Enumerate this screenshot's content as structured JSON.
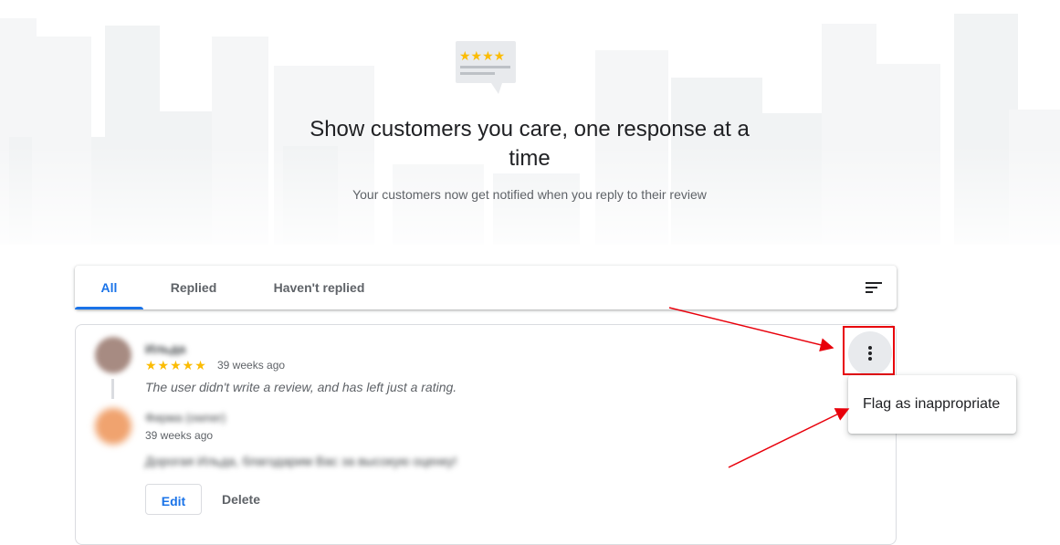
{
  "hero": {
    "title": "Show customers you care, one response at a time",
    "subtitle": "Your customers now get notified when you reply to their review"
  },
  "tabs": [
    {
      "label": "All",
      "active": true
    },
    {
      "label": "Replied",
      "active": false
    },
    {
      "label": "Haven't replied",
      "active": false
    }
  ],
  "review": {
    "reviewer_name": "Ильда",
    "stars": "★★★★★",
    "rating": 5,
    "time": "39 weeks ago",
    "text": "The user didn't write a review, and has left just a rating."
  },
  "owner_reply": {
    "owner_name": "Фирма (owner)",
    "time": "39 weeks ago",
    "text": "Дорогая Ильда, благодарим Вас за высокую оценку!",
    "edit_label": "Edit",
    "delete_label": "Delete"
  },
  "menu": {
    "flag_label": "Flag as inappropriate"
  },
  "icons": {
    "sort": "sort-icon",
    "more": "more-vertical-icon",
    "hero": "review-stars-icon"
  },
  "colors": {
    "accent": "#1a73e8",
    "star": "#fbbc04",
    "annotation": "#e8000b"
  }
}
